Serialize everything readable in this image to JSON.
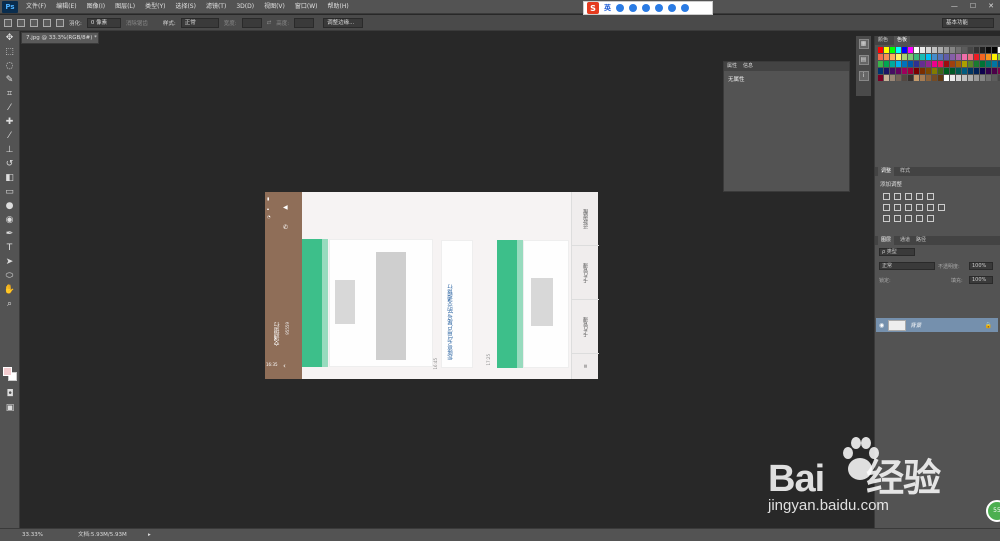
{
  "menubar": {
    "logo": "Ps",
    "items": [
      "文件(F)",
      "编辑(E)",
      "图像(I)",
      "图层(L)",
      "类型(Y)",
      "选择(S)",
      "滤镜(T)",
      "3D(D)",
      "视图(V)",
      "窗口(W)",
      "帮助(H)"
    ],
    "window_controls": [
      "—",
      "☐",
      "✕"
    ]
  },
  "ime": {
    "logo": "S",
    "mode": "英"
  },
  "options": {
    "feather_label": "羽化:",
    "feather_value": "0 像素",
    "antialias": "消除锯齿",
    "style_label": "样式:",
    "style_value": "正常",
    "width_label": "宽度:",
    "height_label": "高度:",
    "refine": "调整边缘...",
    "workspace": "基本功能"
  },
  "document": {
    "tab": "7.jpg @ 33.3%(RGB/8#) *"
  },
  "canvas": {
    "bank_title": "交通银行",
    "bank_sub": "95559",
    "message": "您账号为[用户尾号]的交通银行",
    "time1": "16:35",
    "time2": "16:45",
    "time3": "17:25",
    "side_items": [
      "还款提醒",
      "卡片管理",
      "卡片管理",
      "≡"
    ]
  },
  "properties": {
    "tab1": "属性",
    "tab2": "信息",
    "empty": "无属性"
  },
  "swatches_panel": {
    "tab1": "颜色",
    "tab2": "色板"
  },
  "swatch_colors": [
    "#ff0000",
    "#ffff00",
    "#00ff00",
    "#00ffff",
    "#0000ff",
    "#ff00ff",
    "#ffffff",
    "#ebebeb",
    "#d6d6d6",
    "#c2c2c2",
    "#adadad",
    "#999999",
    "#858585",
    "#707070",
    "#5c5c5c",
    "#474747",
    "#333333",
    "#1f1f1f",
    "#0a0a0a",
    "#000000",
    "#ffffff",
    "#f26c4f",
    "#f68e56",
    "#fbaf5c",
    "#fff467",
    "#acd372",
    "#7cc576",
    "#3bb878",
    "#1abbb4",
    "#00bff3",
    "#438cca",
    "#5574b9",
    "#605ca8",
    "#855fa8",
    "#a763a9",
    "#f06eaa",
    "#f26d7d",
    "#ed1c24",
    "#f26522",
    "#f7941d",
    "#fff200",
    "#8dc63f",
    "#39b54a",
    "#00a651",
    "#00a99d",
    "#00aeef",
    "#0072bc",
    "#0054a6",
    "#2e3192",
    "#662d91",
    "#92278f",
    "#ec008c",
    "#ed145b",
    "#9e0b0f",
    "#a0410d",
    "#a36209",
    "#aba000",
    "#598527",
    "#1a7b30",
    "#007236",
    "#00746b",
    "#0076a3",
    "#004b80",
    "#003471",
    "#1b1464",
    "#440e62",
    "#630460",
    "#9e005d",
    "#9e0039",
    "#790000",
    "#7b2e00",
    "#7d4900",
    "#827b00",
    "#406618",
    "#005e20",
    "#005826",
    "#005952",
    "#005b7f",
    "#003663",
    "#002157",
    "#0d004c",
    "#32004b",
    "#4b0049",
    "#7b0046",
    "#7a0026",
    "#c7b299",
    "#998675",
    "#736357",
    "#534741",
    "#37302d",
    "#c69c6d",
    "#a67c52",
    "#8c6239",
    "#754c24",
    "#603913",
    "#ffffff",
    "#ebebeb",
    "#d6d6d6",
    "#c2c2c2",
    "#adadad",
    "#999999",
    "#858585",
    "#707070",
    "#5c5c5c",
    "#474747"
  ],
  "adjustments": {
    "tab1": "调整",
    "tab2": "样式",
    "title": "添加调整"
  },
  "layers": {
    "tabs": [
      "图层",
      "通道",
      "路径"
    ],
    "kind": "ρ 类型",
    "blend": "正常",
    "opacity_label": "不透明度:",
    "opacity": "100%",
    "lock_label": "锁定:",
    "fill_label": "填充:",
    "fill": "100%",
    "layer_name": "背景"
  },
  "status": {
    "zoom": "33.33%",
    "doc": "文档:5.93M/5.93M"
  },
  "watermark": {
    "brand": "Bai",
    "brand2": "经验",
    "url": "jingyan.baidu.com",
    "badge": "55"
  }
}
